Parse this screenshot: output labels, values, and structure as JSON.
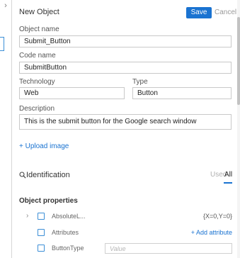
{
  "panel": {
    "title": "New Object",
    "save_label": "Save",
    "cancel_label": "Cancel"
  },
  "fields": {
    "object_name": {
      "label": "Object name",
      "value": "Submit_Button"
    },
    "code_name": {
      "label": "Code name",
      "value": "SubmitButton"
    },
    "technology": {
      "label": "Technology",
      "value": "Web"
    },
    "type": {
      "label": "Type",
      "value": "Button"
    },
    "description": {
      "label": "Description",
      "value": "This is the submit button for the Google search window"
    }
  },
  "upload_label": "+ Upload image",
  "identification": {
    "label": "Identification",
    "tabs": [
      "Used",
      "All"
    ],
    "active_tab": "All"
  },
  "properties": {
    "title": "Object properties",
    "rows": [
      {
        "name": "AbsoluteL...",
        "value": "{X=0,Y=0}"
      },
      {
        "name": "Attributes",
        "link": "+ Add attribute"
      },
      {
        "name": "ButtonType",
        "placeholder": "Value"
      }
    ]
  },
  "colors": {
    "accent": "#1a73d1",
    "checkbox_border": "#3b8ed6"
  },
  "icons": [
    "chevron-right-icon",
    "search-icon"
  ]
}
